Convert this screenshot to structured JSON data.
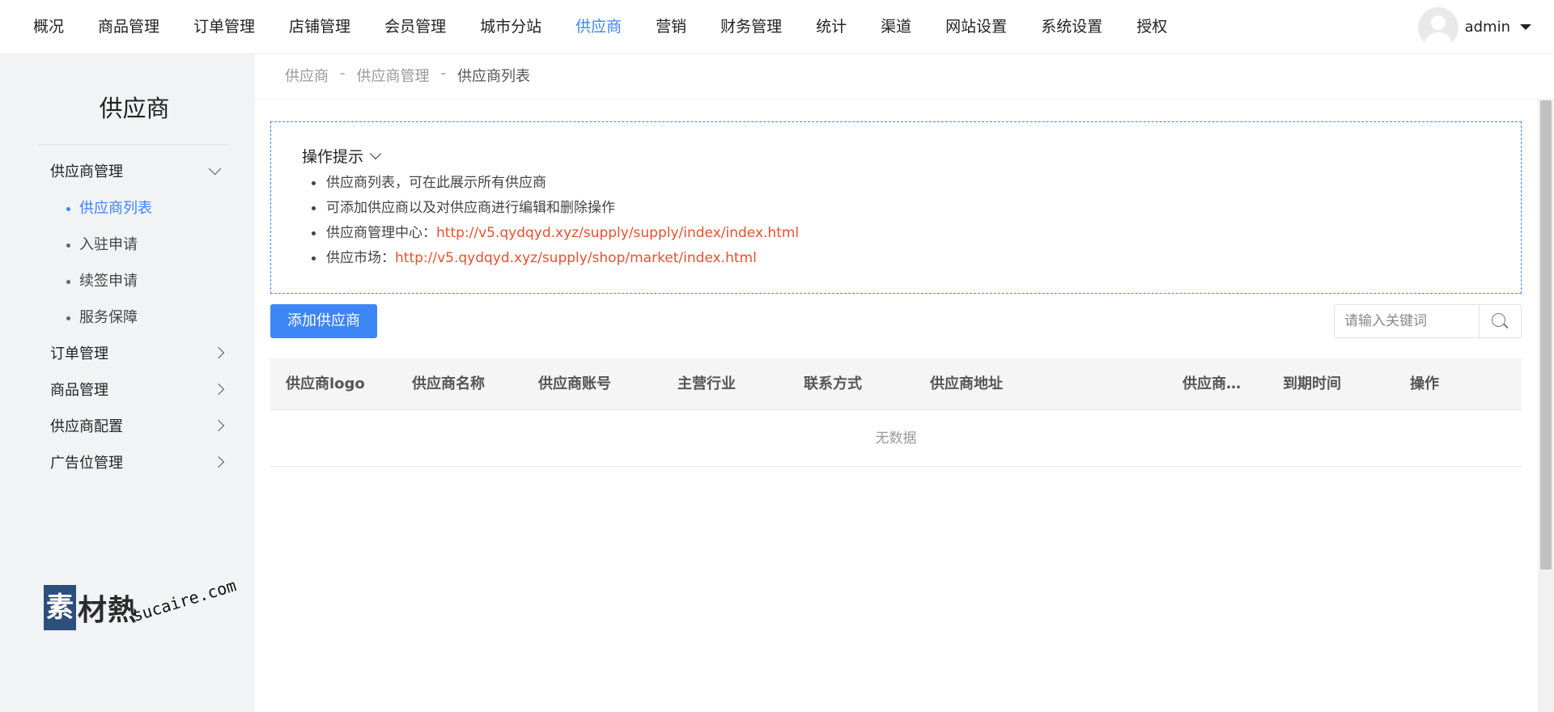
{
  "topnav": {
    "items": [
      "概况",
      "商品管理",
      "订单管理",
      "店铺管理",
      "会员管理",
      "城市分站",
      "供应商",
      "营销",
      "财务管理",
      "统计",
      "渠道",
      "网站设置",
      "系统设置",
      "授权"
    ],
    "active_index": 6
  },
  "user": {
    "name": "admin",
    "avatar_icon": "avatar-icon"
  },
  "sidebar": {
    "title": "供应商",
    "groups": [
      {
        "label": "供应商管理",
        "expanded": true,
        "children": [
          "供应商列表",
          "入驻申请",
          "续签申请",
          "服务保障"
        ],
        "active_child": 0
      },
      {
        "label": "订单管理",
        "expanded": false
      },
      {
        "label": "商品管理",
        "expanded": false
      },
      {
        "label": "供应商配置",
        "expanded": false
      },
      {
        "label": "广告位管理",
        "expanded": false
      }
    ],
    "logo": {
      "mark": "素",
      "text": "材熱",
      "sub": "sucaire.com"
    }
  },
  "breadcrumb": {
    "items": [
      "供应商",
      "供应商管理",
      "供应商列表"
    ],
    "separator": "-"
  },
  "tips": {
    "title": "操作提示",
    "items": [
      {
        "text": "供应商列表，可在此展示所有供应商",
        "link": ""
      },
      {
        "text": "可添加供应商以及对供应商进行编辑和删除操作",
        "link": ""
      },
      {
        "text": "供应商管理中心：",
        "link": "http://v5.qydqyd.xyz/supply/supply/index/index.html"
      },
      {
        "text": "供应市场：",
        "link": "http://v5.qydqyd.xyz/supply/shop/market/index.html"
      }
    ]
  },
  "toolbar": {
    "add_label": "添加供应商",
    "search_placeholder": "请输入关键词"
  },
  "table": {
    "columns": [
      "供应商logo",
      "供应商名称",
      "供应商账号",
      "主营行业",
      "联系方式",
      "供应商地址",
      "供应商…",
      "到期时间",
      "操作"
    ],
    "empty_text": "无数据"
  },
  "colors": {
    "accent": "#3d86f5",
    "link": "#e8502e",
    "sidebar_bg": "#f2f3f5"
  }
}
